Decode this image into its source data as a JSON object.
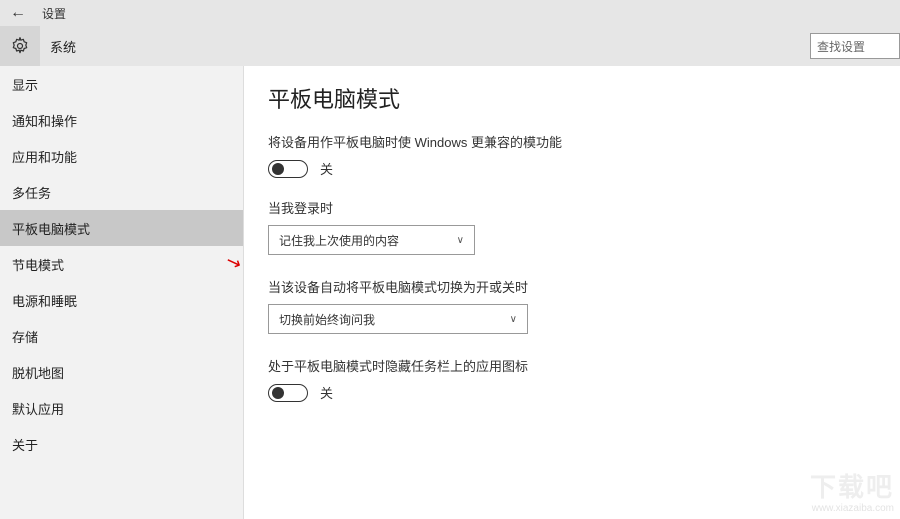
{
  "titlebar": {
    "title": "设置"
  },
  "header": {
    "system_label": "系统",
    "search_placeholder": "查找设置"
  },
  "sidebar": {
    "items": [
      {
        "label": "显示"
      },
      {
        "label": "通知和操作"
      },
      {
        "label": "应用和功能"
      },
      {
        "label": "多任务"
      },
      {
        "label": "平板电脑模式"
      },
      {
        "label": "节电模式"
      },
      {
        "label": "电源和睡眠"
      },
      {
        "label": "存储"
      },
      {
        "label": "脱机地图"
      },
      {
        "label": "默认应用"
      },
      {
        "label": "关于"
      }
    ],
    "selected_index": 4
  },
  "content": {
    "page_title": "平板电脑模式",
    "setting1": {
      "desc": "将设备用作平板电脑时使 Windows 更兼容的模功能",
      "toggle_state": "off",
      "toggle_label": "关"
    },
    "setting2": {
      "label": "当我登录时",
      "dropdown_value": "记住我上次使用的内容"
    },
    "setting3": {
      "label": "当该设备自动将平板电脑模式切换为开或关时",
      "dropdown_value": "切换前始终询问我"
    },
    "setting4": {
      "desc": "处于平板电脑模式时隐藏任务栏上的应用图标",
      "toggle_state": "off",
      "toggle_label": "关"
    }
  },
  "watermark": {
    "line1": "下载吧",
    "line2": "www.xiazaiba.com"
  }
}
